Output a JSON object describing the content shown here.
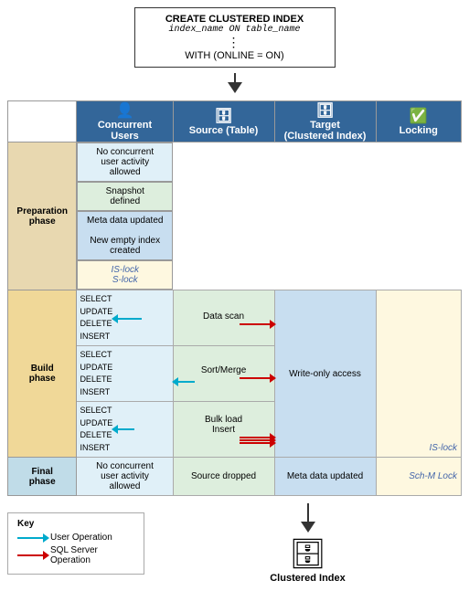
{
  "title": "CREATE CLUSTERED INDEX diagram",
  "top_box": {
    "line1": "CREATE CLUSTERED INDEX",
    "line2": "index_name ON table_name",
    "dots": "⋮",
    "line3": "WITH (ONLINE = ON)"
  },
  "headers": [
    {
      "id": "concurrent",
      "label": "Concurrent\nUsers",
      "icon": "👤"
    },
    {
      "id": "source",
      "label": "Source (Table)",
      "icon": "🗄"
    },
    {
      "id": "target",
      "label": "Target\n(Clustered Index)",
      "icon": "🗄"
    },
    {
      "id": "locking",
      "label": "Locking",
      "icon": "✅"
    }
  ],
  "phases": {
    "preparation": {
      "label": "Preparation\nphase",
      "concurrent": "No concurrent\nuser activity\nallowed",
      "source": "Snapshot\ndefined",
      "target": "Meta data updated\nNew empty index\ncreated",
      "locking_lines": [
        "IS-lock",
        "S-lock"
      ]
    },
    "build": {
      "label": "Build\nphase",
      "rows": [
        {
          "ops": [
            "SELECT",
            "UPDATE",
            "DELETE",
            "INSERT"
          ],
          "source_label": "Data scan",
          "has_blue_arrow": true,
          "has_red_arrows": 1
        },
        {
          "ops": [
            "SELECT",
            "UPDATE",
            "DELETE",
            "INSERT"
          ],
          "source_label": "Sort/Merge",
          "has_blue_arrow": false,
          "has_red_arrows": 1
        },
        {
          "ops": [
            "SELECT",
            "UPDATE",
            "DELETE",
            "INSERT"
          ],
          "source_label": "Bulk load\nInsert",
          "has_blue_arrow": false,
          "has_red_arrows": 3
        }
      ],
      "target_label": "Write-only access",
      "locking_lines": [
        "IS-lock"
      ]
    },
    "final": {
      "label": "Final\nphase",
      "concurrent": "No concurrent\nuser activity\nallowed",
      "source": "Source dropped",
      "target": "Meta data updated",
      "locking_lines": [
        "Sch-M Lock"
      ]
    }
  },
  "key": {
    "title": "Key",
    "items": [
      {
        "type": "blue",
        "label": "User Operation"
      },
      {
        "type": "red",
        "label": "SQL Server Operation"
      }
    ]
  },
  "clustered_index_label": "Clustered Index"
}
